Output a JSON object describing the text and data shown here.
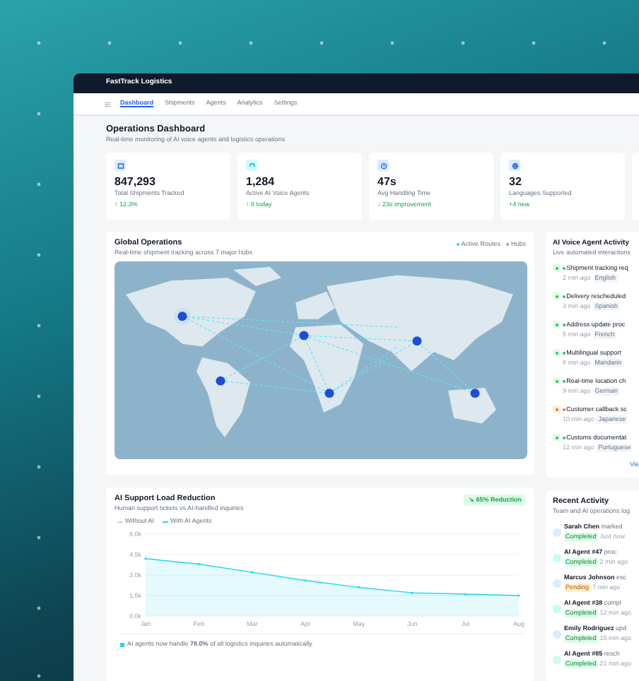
{
  "app": {
    "name": "FastTrack Logistics"
  },
  "nav": [
    {
      "label": "Dashboard",
      "selected": true
    },
    {
      "label": "Shipments",
      "selected": false
    },
    {
      "label": "Agents",
      "selected": false
    },
    {
      "label": "Analytics",
      "selected": false
    },
    {
      "label": "Settings",
      "selected": false
    }
  ],
  "header": {
    "title": "Operations Dashboard",
    "subtitle": "Real-time monitoring of AI voice agents and logistics operations"
  },
  "stats": [
    {
      "value": "847,293",
      "label": "Total Shipments Tracked",
      "change": "↑ 12.3%"
    },
    {
      "value": "1,284",
      "label": "Active AI Voice Agents",
      "change": "↑ 8 today"
    },
    {
      "value": "47s",
      "label": "Avg Handling Time",
      "change": "↓ 23s improvement"
    },
    {
      "value": "32",
      "label": "Languages Supported",
      "change": "+4 new"
    }
  ],
  "global_operations": {
    "title": "Global Operations",
    "subtitle": "Real-time shipment tracking across 7 major hubs",
    "legend": [
      {
        "label": "Active Routes",
        "color": "#22d3ee"
      },
      {
        "label": "Hubs",
        "color": "#94a3b8"
      }
    ]
  },
  "voice_activity": {
    "title": "AI Voice Agent Activity",
    "subtitle": "Live automated interactions",
    "items": [
      {
        "text": "Shipment tracking req",
        "time": "2 min ago",
        "language": "English",
        "kind": "success"
      },
      {
        "text": "Delivery rescheduled",
        "time": "3 min ago",
        "language": "Spanish",
        "kind": "success"
      },
      {
        "text": "Address update proc",
        "time": "5 min ago",
        "language": "French",
        "kind": "success"
      },
      {
        "text": "Multilingual support",
        "time": "8 min ago",
        "language": "Mandarin",
        "kind": "success"
      },
      {
        "text": "Real-time location ch",
        "time": "9 min ago",
        "language": "German",
        "kind": "success"
      },
      {
        "text": "Customer callback sc",
        "time": "10 min ago",
        "language": "Japanese",
        "kind": "callback"
      },
      {
        "text": "Customs documentat",
        "time": "12 min ago",
        "language": "Portuguese",
        "kind": "success"
      }
    ],
    "link": "Vie"
  },
  "load_reduction": {
    "title": "AI Support Load Reduction",
    "subtitle": "Human support tickets vs AI-handled inquiries",
    "badge": "↘ 65% Reduction",
    "legend": [
      {
        "label": "Without AI",
        "color": "#cbd5e1"
      }
    ],
    "chart_data": {
      "type": "area",
      "grid": true,
      "categories": [
        "Jan",
        "Feb",
        "Mar",
        "Apr",
        "May",
        "Jun",
        "Jul",
        "Aug"
      ],
      "series": [
        {
          "name": "With AI Agents",
          "color": "#22d3ee",
          "values": [
            4.2,
            3.8,
            3.2,
            2.6,
            2.1,
            1.7,
            1.6,
            1.5
          ]
        }
      ],
      "ylim": [
        0,
        6
      ],
      "yticks": [
        {
          "value": 0,
          "label": "0.0k"
        },
        {
          "value": 1.5,
          "label": "1.5k"
        },
        {
          "value": 3,
          "label": "3.0k"
        },
        {
          "value": 4.5,
          "label": "4.5k"
        },
        {
          "value": 6,
          "label": "6.0k"
        }
      ]
    },
    "footnote": "AI agents now handle **78.0%** of all logistics inquiries automatically"
  },
  "recent_activity": {
    "title": "Recent Activity",
    "subtitle": "Team and AI operations log",
    "items": [
      {
        "name": "Sarah Chen",
        "action": "marked",
        "status": "Completed",
        "pending": false,
        "time": "Just now",
        "kind": "person"
      },
      {
        "name": "AI Agent #47",
        "action": "proc",
        "status": "Completed",
        "pending": false,
        "time": "2 min ago",
        "kind": "agent"
      },
      {
        "name": "Marcus Johnson",
        "action": "esc",
        "status": "Pending",
        "pending": true,
        "time": "7 min ago",
        "kind": "person"
      },
      {
        "name": "AI Agent #38",
        "action": "compl",
        "status": "Completed",
        "pending": false,
        "time": "12 min ago",
        "kind": "agent"
      },
      {
        "name": "Emily Rodriguez",
        "action": "upd",
        "status": "Completed",
        "pending": false,
        "time": "15 min ago",
        "kind": "person"
      },
      {
        "name": "AI Agent #85",
        "action": "resch",
        "status": "Completed",
        "pending": false,
        "time": "21 min ago",
        "kind": "agent"
      }
    ]
  }
}
